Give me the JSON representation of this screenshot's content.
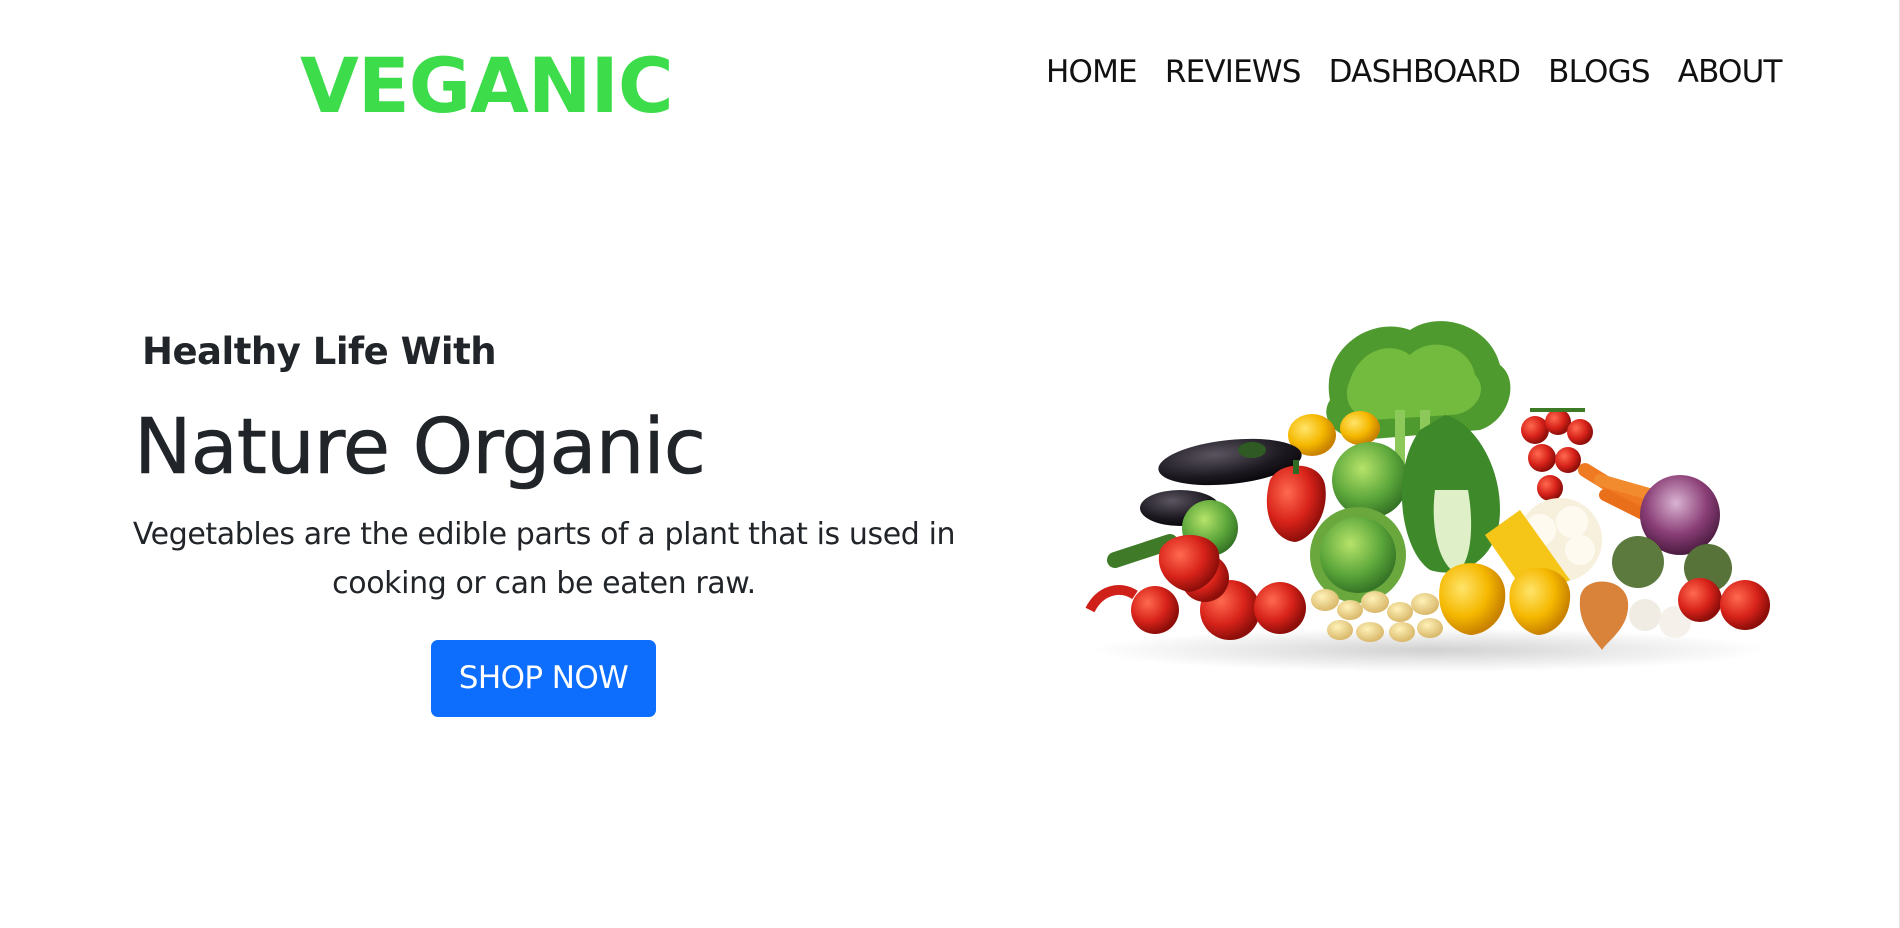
{
  "brand": {
    "name": "VEGANIC",
    "color": "#3ddc4b"
  },
  "nav": {
    "items": [
      {
        "label": "HOME"
      },
      {
        "label": "REVIEWS"
      },
      {
        "label": "DASHBOARD"
      },
      {
        "label": "BLOGS"
      },
      {
        "label": "ABOUT"
      }
    ]
  },
  "hero": {
    "kicker": "Healthy Life With",
    "title": "Nature Organic",
    "description": "Vegetables are the edible parts of a plant that is used in cooking or can be eaten raw.",
    "cta_label": "SHOP NOW",
    "cta_color": "#0d6efd",
    "image_icon": "vegetables-pile-image"
  }
}
